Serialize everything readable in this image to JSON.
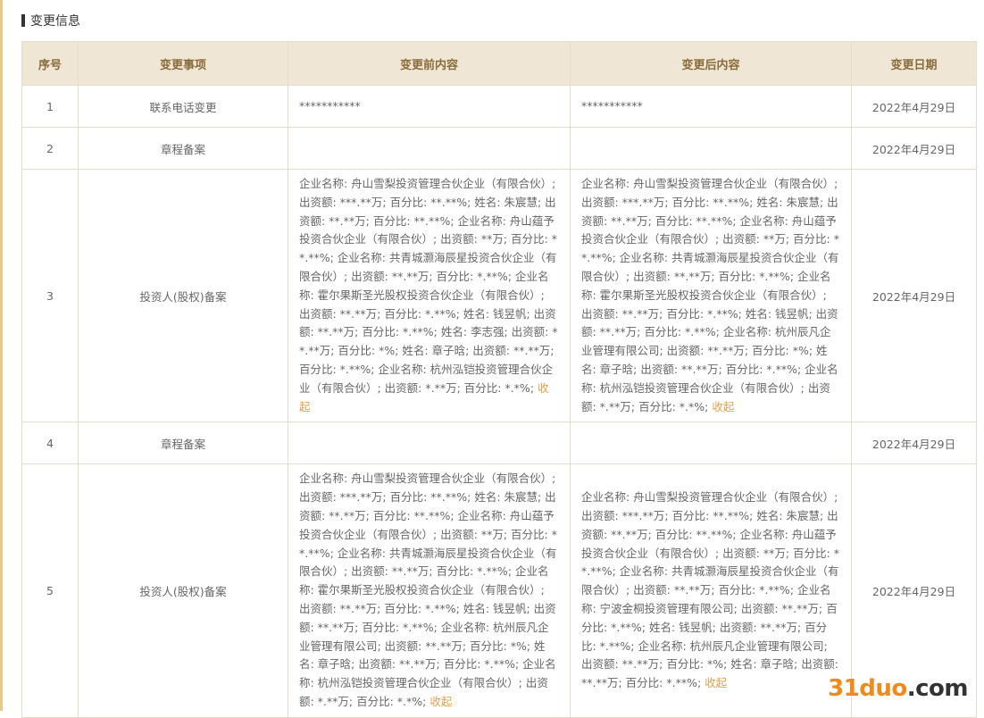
{
  "section": {
    "title": "变更信息"
  },
  "table": {
    "headers": [
      "序号",
      "变更事项",
      "变更前内容",
      "变更后内容",
      "变更日期"
    ],
    "collapse_label": "收起",
    "rows": [
      {
        "no": "1",
        "item": "联系电话变更",
        "before": "***********",
        "after": "***********",
        "date": "2022年4月29日"
      },
      {
        "no": "2",
        "item": "章程备案",
        "before": "",
        "after": "",
        "date": "2022年4月29日"
      },
      {
        "no": "3",
        "item": "投资人(股权)备案",
        "before": "企业名称: 舟山雪梨投资管理合伙企业（有限合伙）; 出资额: ***.**万; 百分比: **.**%; 姓名: 朱宸慧; 出资额: **.**万; 百分比: **.**%; 企业名称: 舟山蕴予投资合伙企业（有限合伙）; 出资额: **万; 百分比: **.**%; 企业名称: 共青城灏海辰星投资合伙企业（有限合伙）; 出资额: **.**万; 百分比: *.**%; 企业名称: 霍尔果斯圣光股权投资合伙企业（有限合伙）; 出资额: **.**万; 百分比: *.**%; 姓名: 钱昱帆; 出资额: **.**万; 百分比: *.**%; 姓名: 李志强; 出资额: **.**万; 百分比: *%; 姓名: 章子晗; 出资额: **.**万; 百分比: *.**%; 企业名称: 杭州泓铠投资管理合伙企业（有限合伙）; 出资额: *.**万; 百分比: *.*%; ",
        "after": "企业名称: 舟山雪梨投资管理合伙企业（有限合伙）; 出资额: ***.**万; 百分比: **.**%; 姓名: 朱宸慧; 出资额: **.**万; 百分比: **.**%; 企业名称: 舟山蕴予投资合伙企业（有限合伙）; 出资额: **万; 百分比: **.**%; 企业名称: 共青城灏海辰星投资合伙企业（有限合伙）; 出资额: **.**万; 百分比: *.**%; 企业名称: 霍尔果斯圣光股权投资合伙企业（有限合伙）; 出资额: **.**万; 百分比: *.**%; 姓名: 钱昱帆; 出资额: **.**万; 百分比: *.**%; 企业名称: 杭州辰凡企业管理有限公司; 出资额: **.**万; 百分比: *%; 姓名: 章子晗; 出资额: **.**万; 百分比: *.**%; 企业名称: 杭州泓铠投资管理合伙企业（有限合伙）; 出资额: *.**万; 百分比: *.*%; ",
        "date": "2022年4月29日"
      },
      {
        "no": "4",
        "item": "章程备案",
        "before": "",
        "after": "",
        "date": "2022年4月29日"
      },
      {
        "no": "5",
        "item": "投资人(股权)备案",
        "before": "企业名称: 舟山雪梨投资管理合伙企业（有限合伙）; 出资额: ***.**万; 百分比: **.**%; 姓名: 朱宸慧; 出资额: **.**万; 百分比: **.**%; 企业名称: 舟山蕴予投资合伙企业（有限合伙）; 出资额: **万; 百分比: **.**%; 企业名称: 共青城灏海辰星投资合伙企业（有限合伙）; 出资额: **.**万; 百分比: *.**%; 企业名称: 霍尔果斯圣光股权投资合伙企业（有限合伙）; 出资额: **.**万; 百分比: *.**%; 姓名: 钱昱帆; 出资额: **.**万; 百分比: *.**%; 企业名称: 杭州辰凡企业管理有限公司; 出资额: **.**万; 百分比: *%; 姓名: 章子晗; 出资额: **.**万; 百分比: *.**%; 企业名称: 杭州泓铠投资管理合伙企业（有限合伙）; 出资额: *.**万; 百分比: *.*%; ",
        "after": "企业名称: 舟山雪梨投资管理合伙企业（有限合伙）; 出资额: ***.**万; 百分比: **.**%; 姓名: 朱宸慧; 出资额: **.**万; 百分比: **.**%; 企业名称: 舟山蕴予投资合伙企业（有限合伙）; 出资额: **万; 百分比: **.**%; 企业名称: 共青城灏海辰星投资合伙企业（有限合伙）; 出资额: **.**万; 百分比: *.**%; 企业名称: 宁波金桐投资管理有限公司; 出资额: **.**万; 百分比: *.**%; 姓名: 钱昱帆; 出资额: **.**万; 百分比: *.**%; 企业名称: 杭州辰凡企业管理有限公司; 出资额: **.**万; 百分比: *%; 姓名: 章子晗; 出资额: **.**万; 百分比: *.**%; ",
        "date": "2022年4月29日"
      }
    ]
  },
  "watermark": {
    "part1": "31duo",
    "part2": ".com"
  },
  "colors": {
    "header_bg": "#efe6d6",
    "header_text": "#8a6b3a",
    "border": "#e6dcc8",
    "link": "#e8a04a",
    "watermark_accent": "#f08a1c"
  }
}
